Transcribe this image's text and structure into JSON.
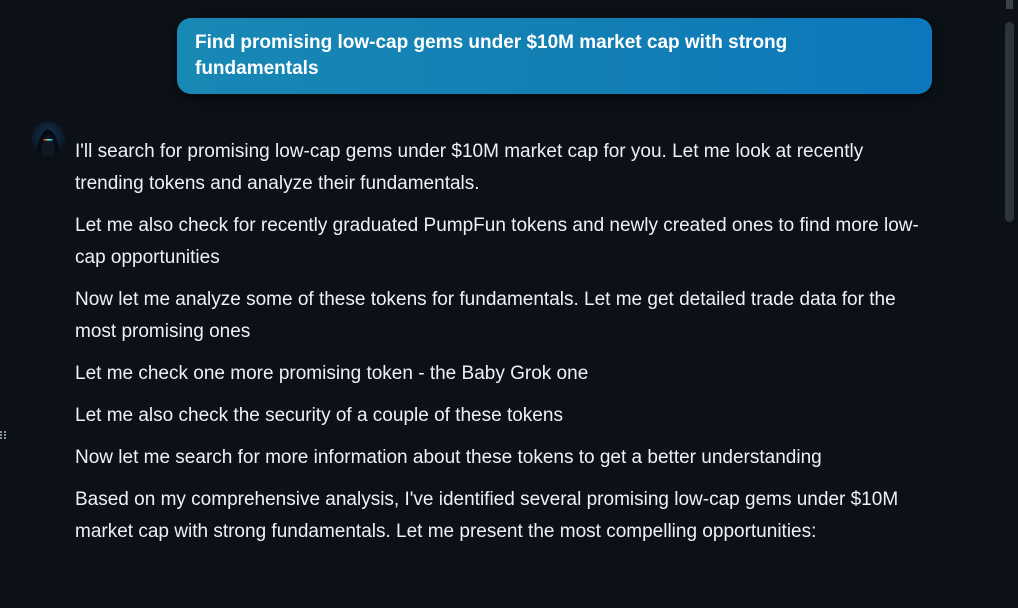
{
  "user_message": {
    "text": "Find promising low-cap gems under $10M market cap with strong fundamentals"
  },
  "assistant_message": {
    "avatar_icon": "hooded-figure-icon",
    "paragraphs": [
      "I'll search for promising low-cap gems under $10M market cap for you. Let me look at recently trending tokens and analyze their fundamentals.",
      "Let me also check for recently graduated PumpFun tokens and newly created ones to find more low-cap opportunities",
      "Now let me analyze some of these tokens for fundamentals. Let me get detailed trade data for the most promising ones",
      "Let me check one more promising token - the Baby Grok one",
      "Let me also check the security of a couple of these tokens",
      "Now let me search for more information about these tokens to get a better understanding",
      "Based on my comprehensive analysis, I've identified several promising low-cap gems under $10M market cap with strong fundamentals. Let me present the most compelling opportunities:"
    ]
  },
  "colors": {
    "background": "#0c1117",
    "bubble_start": "#1888b5",
    "bubble_end": "#0c78bd",
    "text": "#eef1f5"
  }
}
